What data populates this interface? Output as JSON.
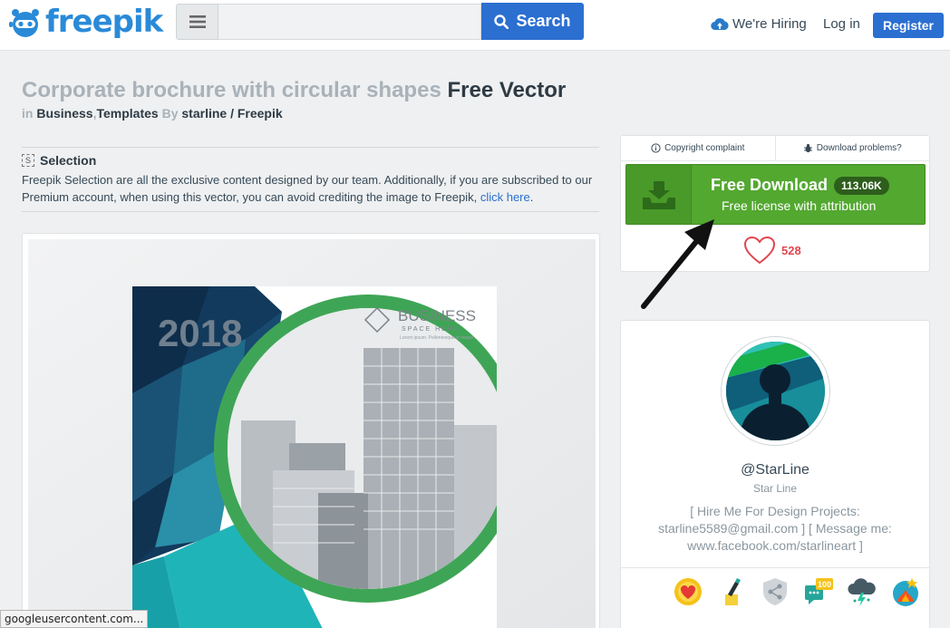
{
  "header": {
    "logo_text": "freepik",
    "search_placeholder": "",
    "search_label": "Search",
    "hiring_label": "We're Hiring",
    "login_label": "Log in",
    "register_label": "Register"
  },
  "resource": {
    "title_muted": "Corporate brochure with circular shapes",
    "title_strong": "Free Vector",
    "in_label": "in",
    "category_1": "Business",
    "category_sep": ",",
    "category_2": "Templates",
    "by_label": "By",
    "author_link": "starline / Freepik"
  },
  "selection": {
    "icon_letter": "S",
    "heading": "Selection",
    "text": "Freepik Selection are all the exclusive content designed by our team. Additionally, if you are subscribed to our Premium account, when using this vector, you can avoid crediting the image to Freepik,",
    "link": "click here",
    "period": "."
  },
  "preview": {
    "year": "2018",
    "brand": "BUSINESS",
    "tagline": "SPACE HERE",
    "small_text": "Lorem ipsum. Pellentesque id neque"
  },
  "download": {
    "copyright_label": "Copyright complaint",
    "problems_label": "Download problems?",
    "main_label": "Free Download",
    "count": "113.06K",
    "sub_label": "Free license with attribution",
    "likes": "528"
  },
  "author": {
    "handle": "@StarLine",
    "name": "Star Line",
    "bio": "[ Hire Me For Design Projects: starline5589@gmail.com ] [ Message me: www.facebook.com/starlineart ]",
    "badge_100": "100"
  },
  "status_bar": {
    "text": "googleusercontent.com..."
  },
  "colors": {
    "brand_blue": "#2b6fd1",
    "download_green": "#53a830",
    "like_red": "#e0464e"
  }
}
